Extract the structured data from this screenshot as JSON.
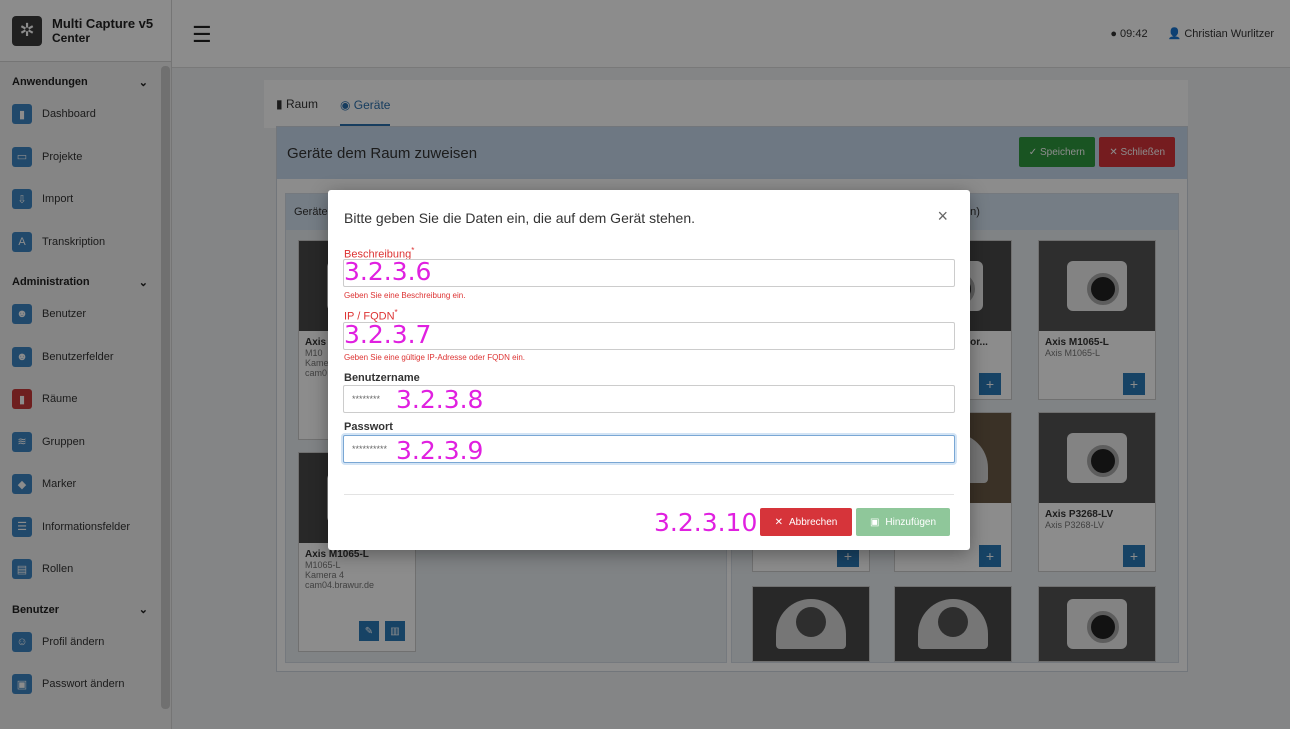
{
  "app": {
    "title": "Multi Capture v5",
    "subtitle": "Center"
  },
  "sidebar": {
    "sections": [
      {
        "label": "Anwendungen",
        "items": [
          {
            "label": "Dashboard",
            "icon": "door-icon"
          },
          {
            "label": "Projekte",
            "icon": "monitor-icon"
          },
          {
            "label": "Import",
            "icon": "upload-icon"
          },
          {
            "label": "Transkription",
            "icon": "text-icon",
            "glyph": "A"
          }
        ]
      },
      {
        "label": "Administration",
        "items": [
          {
            "label": "Benutzer",
            "icon": "users-icon"
          },
          {
            "label": "Benutzerfelder",
            "icon": "users-icon"
          },
          {
            "label": "Räume",
            "icon": "door-icon"
          },
          {
            "label": "Gruppen",
            "icon": "layers-icon"
          },
          {
            "label": "Marker",
            "icon": "tag-icon"
          },
          {
            "label": "Informationsfelder",
            "icon": "list-icon"
          },
          {
            "label": "Rollen",
            "icon": "id-icon"
          }
        ]
      },
      {
        "label": "Benutzer",
        "items": [
          {
            "label": "Profil ändern",
            "icon": "user-icon"
          },
          {
            "label": "Passwort ändern",
            "icon": "lock-icon"
          }
        ]
      }
    ]
  },
  "topbar": {
    "time": "09:42",
    "user": "Christian Wurlitzer"
  },
  "tabs": [
    {
      "label": "Raum"
    },
    {
      "label": "Geräte",
      "active": true
    }
  ],
  "panel": {
    "title": "Geräte dem Raum zuweisen",
    "save": "Speichern",
    "close": "Schließen"
  },
  "left_sub": {
    "title": "Geräte"
  },
  "right_sub": {
    "title": "en)"
  },
  "left_cards": [
    {
      "title": "Axis",
      "lines": [
        "M10",
        "Kame",
        "cam0"
      ]
    },
    {
      "title": "Axis M1065-L",
      "lines": [
        "M1065-L",
        "Kamera 4",
        "cam04.brawur.de"
      ]
    }
  ],
  "right_cards": [
    {
      "title": "twor...",
      "sub": ""
    },
    {
      "title": "Axis M1065-L",
      "sub": "Axis M1065-L"
    },
    {
      "title": "Axis P3268-LV",
      "sub": "Axis P3268-LV"
    }
  ],
  "modal": {
    "title": "Bitte geben Sie die Daten ein, die auf dem Gerät stehen.",
    "fields": {
      "description": {
        "label": "Beschreibung",
        "value": "",
        "help": "Geben Sie eine Beschreibung ein."
      },
      "ip": {
        "label": "IP / FQDN",
        "value": "",
        "help": "Geben Sie eine gültige IP-Adresse oder FQDN ein."
      },
      "username": {
        "label": "Benutzername",
        "value": "********"
      },
      "password": {
        "label": "Passwort",
        "value": "**********"
      }
    },
    "cancel": "Abbrechen",
    "add": "Hinzufügen"
  },
  "annotations": {
    "a1": "3.2.3.6",
    "a2": "3.2.3.7",
    "a3": "3.2.3.8",
    "a4": "3.2.3.9",
    "a5": "3.2.3.10"
  }
}
